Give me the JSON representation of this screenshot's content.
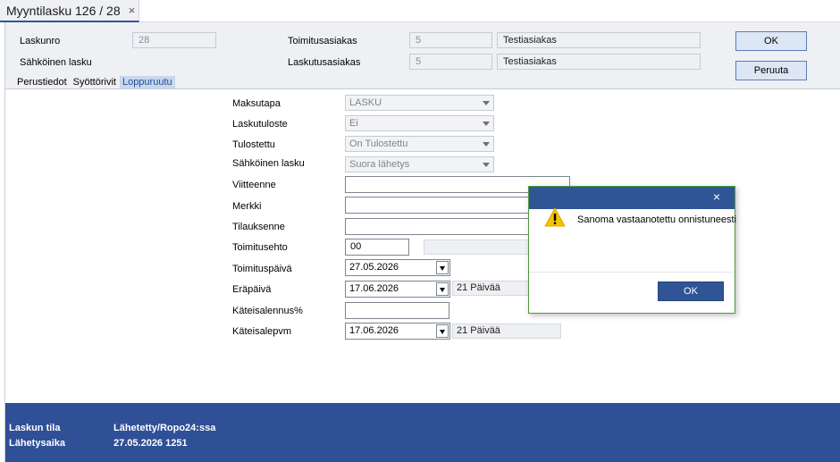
{
  "tab": {
    "title": "Myyntilasku 126 / 28",
    "close": "×"
  },
  "header": {
    "laskunro_label": "Laskunro",
    "laskunro_value": "28",
    "sahkoinen_label": "Sähköinen lasku",
    "toimitusasiakas_label": "Toimitusasiakas",
    "toimitusasiakas_no": "5",
    "toimitusasiakas_name": "Testiasiakas",
    "laskutusasiakas_label": "Laskutusasiakas",
    "laskutusasiakas_no": "5",
    "laskutusasiakas_name": "Testiasiakas",
    "ok_label": "OK",
    "cancel_label": "Peruuta"
  },
  "subtabs": [
    {
      "label": "Perustiedot",
      "active": false
    },
    {
      "label": "Syöttörivit",
      "active": false
    },
    {
      "label": "Loppuruutu",
      "active": true
    }
  ],
  "form": {
    "maksutapa_label": "Maksutapa",
    "maksutapa_value": "LASKU",
    "laskutuloste_label": "Laskutuloste",
    "laskutuloste_value": "Ei",
    "tulostettu_label": "Tulostettu",
    "tulostettu_value": "On Tulostettu",
    "sahkoinen_label": "Sähköinen lasku",
    "sahkoinen_value": "Suora lähetys",
    "viitteenne_label": "Viitteenne",
    "viitteenne_value": "",
    "merkki_label": "Merkki",
    "merkki_value": "",
    "tilauksenne_label": "Tilauksenne",
    "tilauksenne_value": "",
    "toimitusehto_label": "Toimitusehto",
    "toimitusehto_value": "00",
    "toimituspaiva_label": "Toimituspäivä",
    "toimituspaiva_value": "27.05.2026",
    "erapaiva_label": "Eräpäivä",
    "erapaiva_value": "17.06.2026",
    "erapaiva_days": "21 Päivää",
    "kateisalennus_label": "Käteisalennus%",
    "kateisalennus_value": "",
    "kateisalepvm_label": "Käteisalepvm",
    "kateisalepvm_value": "17.06.2026",
    "kateisalepvm_days": "21 Päivää"
  },
  "footer": {
    "tila_label": "Laskun tila",
    "tila_value": "Lähetetty/Ropo24:ssa",
    "aika_label": "Lähetysaika",
    "aika_value": "27.05.2026 1251"
  },
  "dialog": {
    "message": "Sanoma vastaanotettu onnistuneesti",
    "ok_label": "OK",
    "close": "×"
  },
  "colors": {
    "accent": "#2f5597",
    "footer_bg": "#2f4f96",
    "dialog_border": "#4f9a3f",
    "warning": "#f5c400"
  }
}
